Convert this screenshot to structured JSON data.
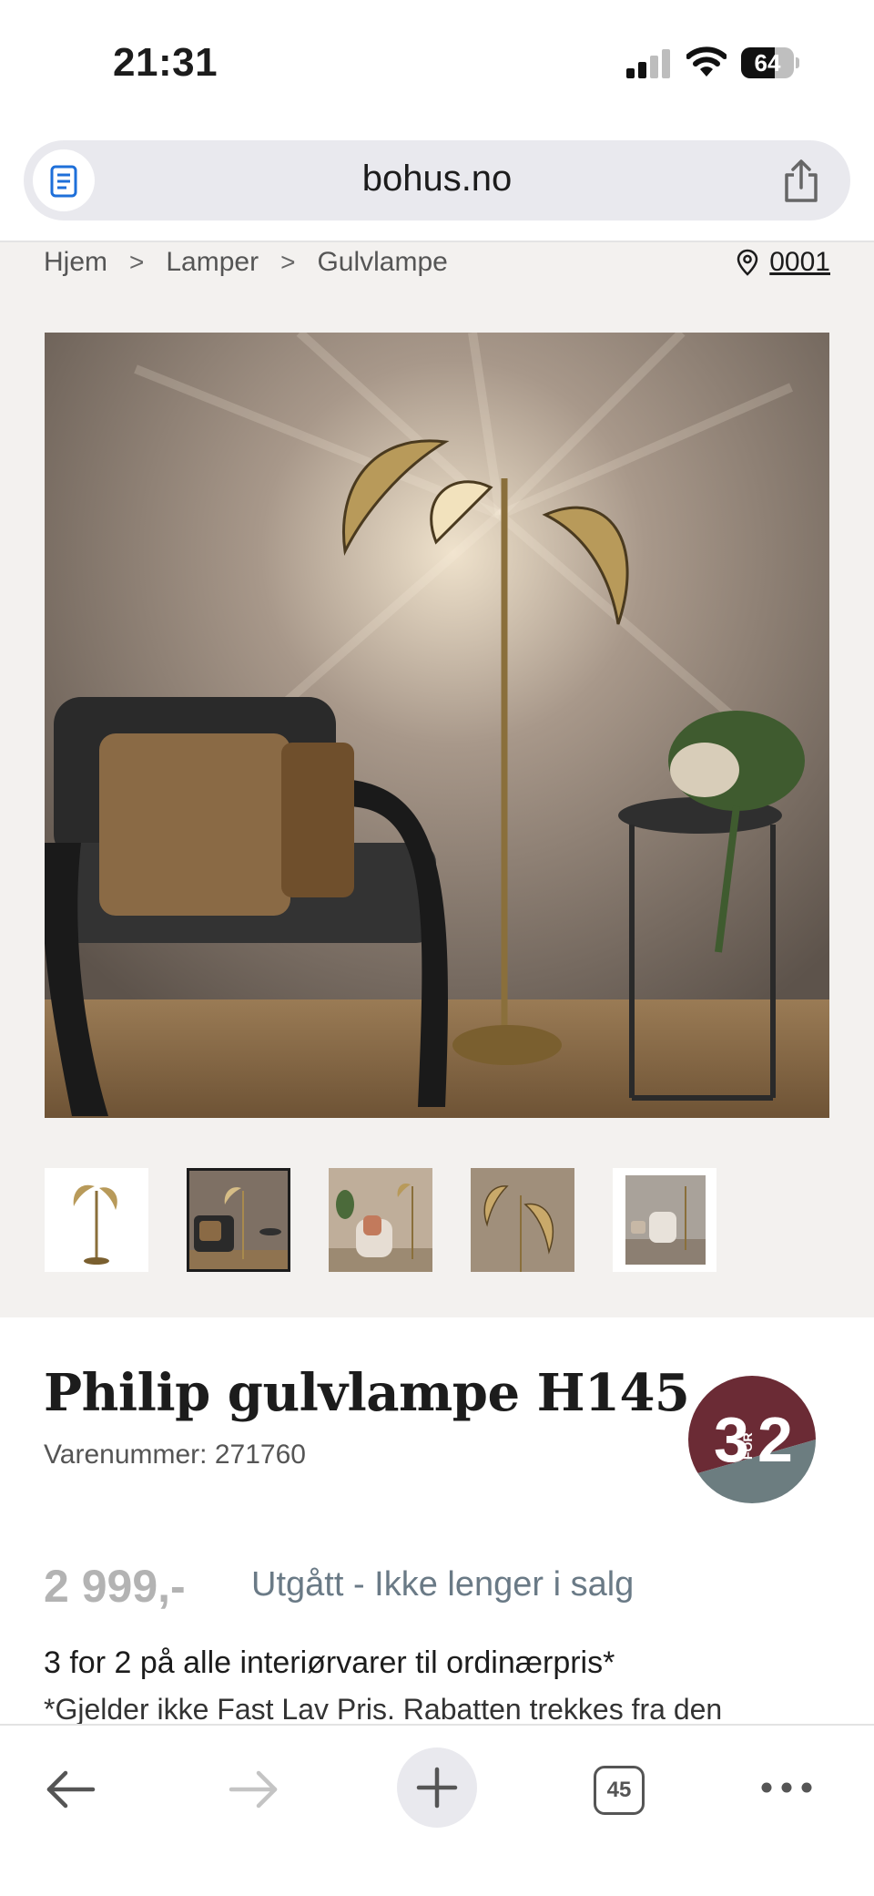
{
  "status_bar": {
    "time": "21:31",
    "battery_level": "64",
    "battery_fraction": 0.64,
    "signal_bars": 4,
    "signal_active": 2
  },
  "browser": {
    "url": "bohus.no",
    "icons": {
      "reader": "reader-icon",
      "share": "share-icon"
    }
  },
  "breadcrumb": {
    "items": [
      "Hjem",
      "Lamper",
      "Gulvlampe"
    ],
    "separator": ">"
  },
  "store": {
    "icon": "location-pin-icon",
    "code": "0001"
  },
  "gallery": {
    "thumb_count": 5,
    "selected_index": 1
  },
  "product": {
    "title": "Philip gulvlampe H145",
    "sku_label": "Varenummer: 271760",
    "promo_badge": {
      "left": "3",
      "middle": "FOR",
      "right": "2",
      "colors": {
        "top": "#6b2b35",
        "bottom": "#6c7d80"
      }
    },
    "price": "2 999,-",
    "availability": "Utgått - Ikke lenger i salg",
    "offer_title": "3 for 2 på alle interiørvarer til ordinærpris*",
    "offer_description": "*Gjelder ikke Fast Lav Pris. Rabatten trekkes fra den"
  },
  "toolbar": {
    "tab_count": "45",
    "icons": [
      "back-arrow-icon",
      "forward-arrow-icon",
      "plus-icon",
      "tabs-icon",
      "more-icon"
    ]
  },
  "colors": {
    "page_bg": "#f3f1ef",
    "title": "#1c1c1c",
    "price_muted": "#b3b3b3",
    "status_muted": "#6a7a86"
  }
}
